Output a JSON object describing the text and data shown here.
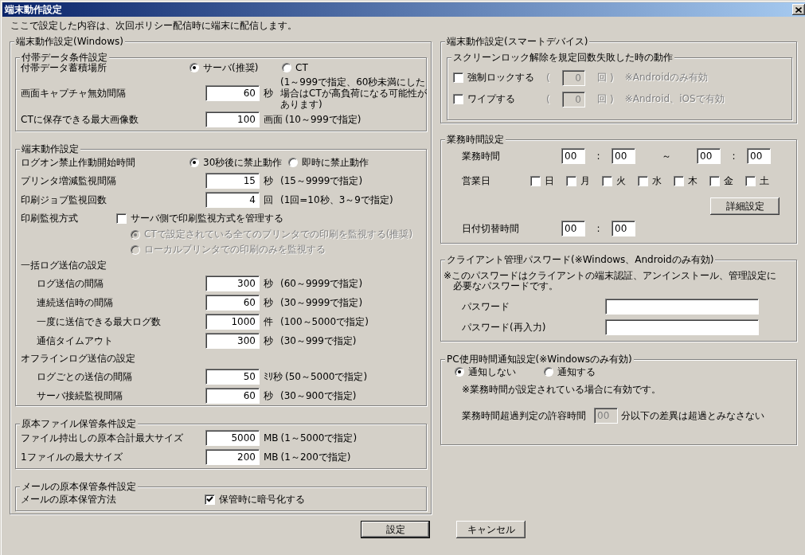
{
  "window": {
    "title": "端末動作設定"
  },
  "intro": "ここで設定した内容は、次回ポリシー配信時に端末に配信します。",
  "windows_settings": {
    "title": "端末動作設定(Windows)",
    "groups": [
      {
        "title": "付帯データ条件設定",
        "rows": [
          {
            "kind": "radio",
            "label": "付帯データ蓄積場所",
            "options": [
              {
                "label": "サーバ(推奨)",
                "selected": true
              },
              {
                "label": "CT",
                "selected": false
              }
            ]
          },
          {
            "kind": "number",
            "label": "画面キャプチャ無効間隔",
            "value": "60",
            "unit": "秒",
            "hint": "(1～999で指定、60秒未満にした場合はCTが高負荷になる可能性があります)"
          },
          {
            "kind": "number",
            "label": "CTに保存できる最大画像数",
            "value": "100",
            "unit": "画面",
            "hint": "(10～999で指定)"
          }
        ]
      },
      {
        "title": "端末動作設定",
        "rows": [
          {
            "kind": "radio",
            "label": "ログオン禁止作動開始時間",
            "options": [
              {
                "label": "30秒後に禁止動作",
                "selected": true
              },
              {
                "label": "即時に禁止動作",
                "selected": false
              }
            ]
          },
          {
            "kind": "number",
            "label": "プリンタ増減監視間隔",
            "value": "15",
            "unit": "秒",
            "hint": "(15～9999で指定)"
          },
          {
            "kind": "number",
            "label": "印刷ジョブ監視回数",
            "value": "4",
            "unit": "回",
            "hint": "(1回=10秒、3～9で指定)"
          },
          {
            "kind": "checkbox",
            "label": "印刷監視方式",
            "checkbox": {
              "label": "サーバ側で印刷監視方式を管理する",
              "checked": false
            },
            "options": [
              {
                "label": "CTで設定されている全てのプリンタでの印刷を監視する(推奨)",
                "selected": true,
                "disabled": true
              },
              {
                "label": "ローカルプリンタでの印刷のみを監視する",
                "selected": false,
                "disabled": true
              }
            ]
          },
          {
            "kind": "heading",
            "label": "一括ログ送信の設定",
            "children": [
              {
                "kind": "number",
                "label": "ログ送信の間隔",
                "value": "300",
                "unit": "秒",
                "hint": "(60～9999で指定)"
              },
              {
                "kind": "number",
                "label": "連続送信時の間隔",
                "value": "60",
                "unit": "秒",
                "hint": "(30～9999で指定)"
              },
              {
                "kind": "number",
                "label": "一度に送信できる最大ログ数",
                "value": "1000",
                "unit": "件",
                "hint": "(100～5000で指定)"
              },
              {
                "kind": "number",
                "label": "通信タイムアウト",
                "value": "300",
                "unit": "秒",
                "hint": "(30～999で指定)"
              }
            ]
          },
          {
            "kind": "heading",
            "label": "オフラインログ送信の設定",
            "children": [
              {
                "kind": "number",
                "label": "ログごとの送信の間隔",
                "value": "50",
                "unit": "ﾐﾘ秒",
                "hint": "(50～5000で指定)"
              },
              {
                "kind": "number",
                "label": "サーバ接続監視間隔",
                "value": "60",
                "unit": "秒",
                "hint": "(30～900で指定)"
              }
            ]
          }
        ]
      },
      {
        "title": "原本ファイル保管条件設定",
        "rows": [
          {
            "kind": "number",
            "label": "ファイル持出しの原本合計最大サイズ",
            "value": "5000",
            "unit": "MB",
            "hint": "(1～5000で指定)"
          },
          {
            "kind": "number",
            "label": "1ファイルの最大サイズ",
            "value": "200",
            "unit": "MB",
            "hint": "(1～200で指定)"
          }
        ]
      },
      {
        "title": "メールの原本保管条件設定",
        "rows": [
          {
            "kind": "check_option",
            "label": "メールの原本保管方法",
            "checkbox": {
              "label": "保管時に暗号化する",
              "checked": true
            }
          }
        ]
      }
    ]
  },
  "smart_device": {
    "title": "端末動作設定(スマートデバイス)",
    "group": {
      "title": "スクリーンロック解除を規定回数失敗した時の動作",
      "rows": [
        {
          "label": "強制ロックする",
          "checked": false,
          "open": "(",
          "count": "0",
          "unit": "回",
          "close": ")",
          "note": "※Androidのみ有効",
          "disabled": true
        },
        {
          "label": "ワイプする",
          "checked": false,
          "open": "(",
          "count": "0",
          "unit": "回",
          "close": ")",
          "note": "※Android、iOSで有効",
          "disabled": true
        }
      ]
    }
  },
  "business_hours": {
    "title": "業務時間設定",
    "work_time": {
      "label": "業務時間",
      "start": {
        "hour": "00",
        "colon": ":",
        "minute": "00"
      },
      "separator": "～",
      "end": {
        "hour": "00",
        "colon": ":",
        "minute": "00"
      }
    },
    "business_days": {
      "label": "営業日",
      "days": [
        {
          "label": "日",
          "checked": false
        },
        {
          "label": "月",
          "checked": false
        },
        {
          "label": "火",
          "checked": false
        },
        {
          "label": "水",
          "checked": false
        },
        {
          "label": "木",
          "checked": false
        },
        {
          "label": "金",
          "checked": false
        },
        {
          "label": "土",
          "checked": false
        }
      ]
    },
    "detail_button": "詳細設定",
    "date_change": {
      "label": "日付切替時間",
      "time": {
        "hour": "00",
        "colon": ":",
        "minute": "00"
      }
    }
  },
  "client_password": {
    "title": "クライアント管理パスワード(※Windows、Androidのみ有効)",
    "note_lines": [
      "※このパスワードはクライアントの端末認証、アンインストール、管理設定に",
      "必要なパスワードです。"
    ],
    "fields": [
      {
        "label": "パスワード"
      },
      {
        "label": "パスワード(再入力)"
      }
    ]
  },
  "pc_usage": {
    "title": "PC使用時間通知設定(※Windowsのみ有効)",
    "options": [
      {
        "label": "通知しない",
        "selected": true
      },
      {
        "label": "通知する",
        "selected": false
      }
    ],
    "note": "※業務時間が設定されている場合に有効です。",
    "tolerance": {
      "label": "業務時間超過判定の許容時間",
      "value": "00",
      "disabled": true,
      "suffix": "分以下の差異は超過とみなさない"
    }
  },
  "buttons": [
    {
      "label": "設定",
      "default": true
    },
    {
      "label": "キャンセル",
      "default": false
    }
  ]
}
